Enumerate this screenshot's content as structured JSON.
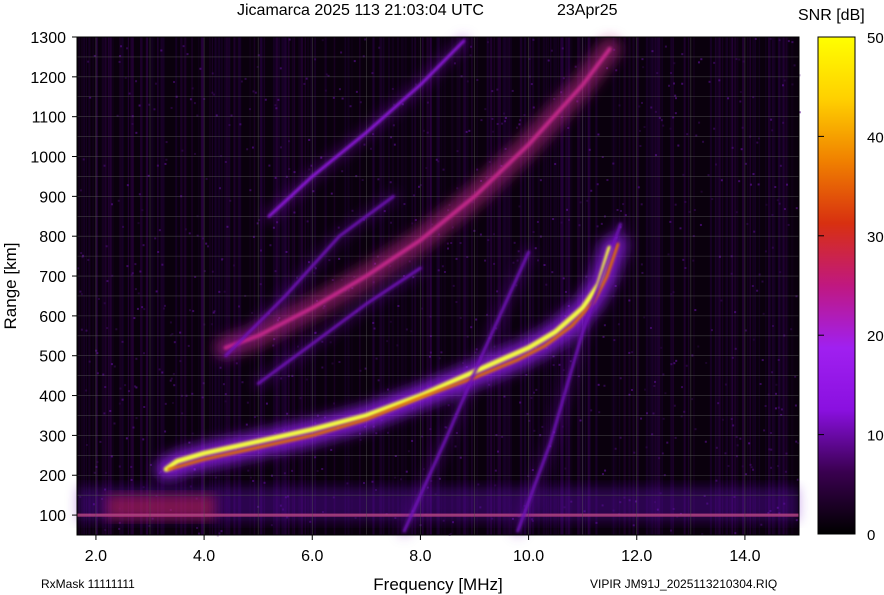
{
  "chart_data": {
    "type": "heatmap",
    "title": "Jicamarca 2025 113 21:03:04 UTC",
    "date": "23Apr25",
    "xlabel": "Frequency [MHz]",
    "ylabel": "Range [km]",
    "xlim": [
      1.65,
      15.0
    ],
    "ylim": [
      50,
      1300
    ],
    "xticks": [
      "2.0",
      "4.0",
      "6.0",
      "8.0",
      "10.0",
      "12.0",
      "14.0"
    ],
    "yticks": [
      "100",
      "200",
      "300",
      "400",
      "500",
      "600",
      "700",
      "800",
      "900",
      "1000",
      "1100",
      "1200",
      "1300"
    ],
    "grid": true,
    "colorbar": {
      "label": "SNR [dB]",
      "range": [
        0,
        50
      ],
      "ticks": [
        "0",
        "10",
        "20",
        "30",
        "40",
        "50"
      ],
      "colors": [
        "#000000",
        "#3a0050",
        "#8a10e0",
        "#a020f0",
        "#c01880",
        "#d83010",
        "#f08000",
        "#ffd000",
        "#ffff00"
      ]
    },
    "traces": [
      {
        "name": "",
        "color": "#f5ff40",
        "x": [
          3.3,
          3.5,
          4.0,
          5.0,
          6.0,
          7.0,
          8.0,
          8.5,
          9.0,
          9.5,
          10.0,
          10.5,
          11.0,
          11.3,
          11.5
        ],
        "y": [
          215,
          235,
          255,
          285,
          315,
          350,
          400,
          430,
          460,
          490,
          520,
          560,
          620,
          680,
          770
        ]
      },
      {
        "name": "",
        "color": "#e07000",
        "x": [
          3.35,
          4.0,
          5.0,
          6.0,
          7.0,
          8.0,
          9.0,
          9.8,
          10.3,
          10.8,
          11.2,
          11.45,
          11.65
        ],
        "y": [
          215,
          240,
          270,
          300,
          340,
          395,
          445,
          490,
          525,
          575,
          635,
          700,
          780
        ]
      },
      {
        "name": "",
        "color": "#c02888",
        "x": [
          4.4,
          5.0,
          6.0,
          7.0,
          8.0,
          9.0,
          10.0,
          10.6,
          11.0,
          11.5
        ],
        "y": [
          520,
          550,
          620,
          700,
          790,
          900,
          1030,
          1120,
          1180,
          1270
        ]
      },
      {
        "name": "",
        "color": "#9018e0",
        "x": [
          5.2,
          6.0,
          7.0,
          8.0,
          8.8
        ],
        "y": [
          850,
          950,
          1060,
          1180,
          1290
        ]
      },
      {
        "name": "",
        "color": "#7010b8",
        "x": [
          5.0,
          6.0,
          7.0,
          8.0
        ],
        "y": [
          430,
          530,
          630,
          720
        ]
      },
      {
        "name": "",
        "color": "#7010b8",
        "x": [
          7.7,
          8.5,
          9.2,
          10.0
        ],
        "y": [
          60,
          300,
          520,
          760
        ]
      },
      {
        "name": "",
        "color": "#7010b8",
        "x": [
          9.8,
          10.4,
          11.0,
          11.7
        ],
        "y": [
          60,
          280,
          560,
          830
        ]
      },
      {
        "name": "",
        "color": "#7010b8",
        "x": [
          4.4,
          5.5,
          6.5,
          7.5
        ],
        "y": [
          500,
          650,
          800,
          900
        ]
      }
    ],
    "footer_left": "RxMask 11111111",
    "footer_right": "VIPIR  JM91J_2025113210304.RIQ"
  }
}
